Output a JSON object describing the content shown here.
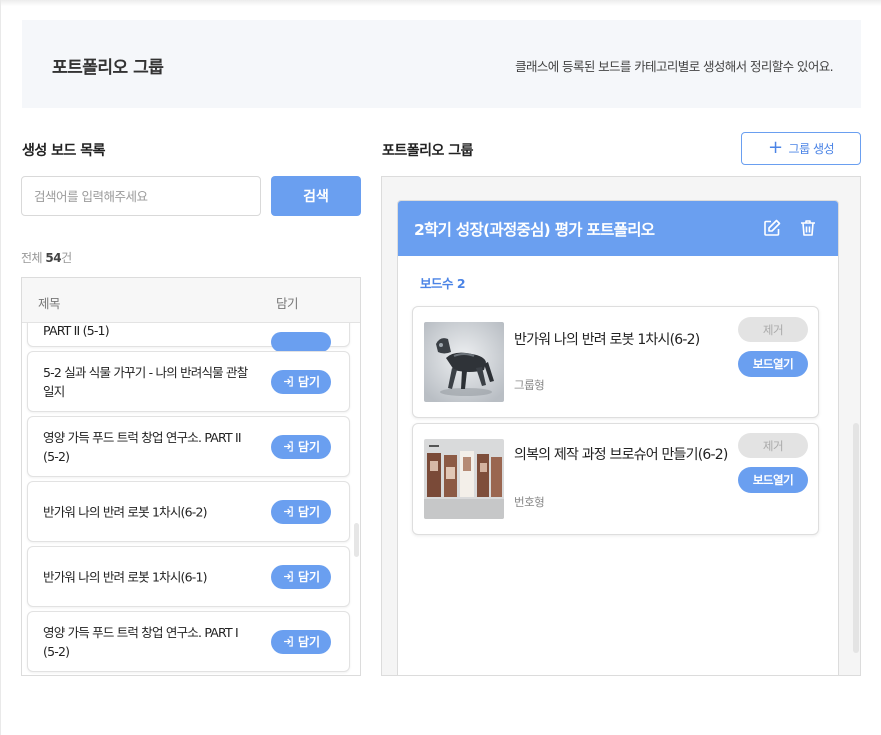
{
  "header": {
    "title": "포트폴리오 그룹",
    "description": "클래스에 등록된 보드를 카테고리별로 생성해서 정리할수 있어요."
  },
  "left": {
    "section_title": "생성 보드 목록",
    "search": {
      "placeholder": "검색어를 입력해주세요",
      "value": "",
      "button_label": "검색"
    },
    "count": {
      "prefix": "전체",
      "number": "54",
      "suffix": "건"
    },
    "columns": {
      "title": "제목",
      "add": "담기"
    },
    "partial_item_title": "PART II (5-1)",
    "add_button_label": "담기",
    "items": [
      {
        "title": "5-2 실과 식물 가꾸기 - 나의 반려식물 관찰일지"
      },
      {
        "title": "영양 가득 푸드 트럭 창업 연구소. PART II (5-2)"
      },
      {
        "title": "반가워 나의 반려 로봇 1차시(6-2)"
      },
      {
        "title": "반가워 나의 반려 로봇 1차시(6-1)"
      },
      {
        "title": "영양 가득 푸드 트럭 창업 연구소. PART I (5-2)"
      }
    ]
  },
  "right": {
    "section_title": "포트폴리오 그룹",
    "create_button_label": "그룹 생성",
    "group": {
      "title": "2학기 성장(과정중심) 평가 포트폴리오",
      "board_count_label": "보드수",
      "board_count": "2",
      "boards": [
        {
          "title": "반가워 나의 반려 로봇 1차시(6-2)",
          "type": "그룹형",
          "remove_label": "제거",
          "open_label": "보드열기",
          "thumb_icon": "robot-dog-image"
        },
        {
          "title": "의복의 제작 과정 브로슈어 만들기(6-2)",
          "type": "번호형",
          "remove_label": "제거",
          "open_label": "보드열기",
          "thumb_icon": "brochure-image"
        }
      ]
    }
  },
  "colors": {
    "accent": "#6a9ff0",
    "accent_text": "#4b84e6",
    "header_band": "#f5f7fa",
    "disabled": "#e3e3e3"
  }
}
